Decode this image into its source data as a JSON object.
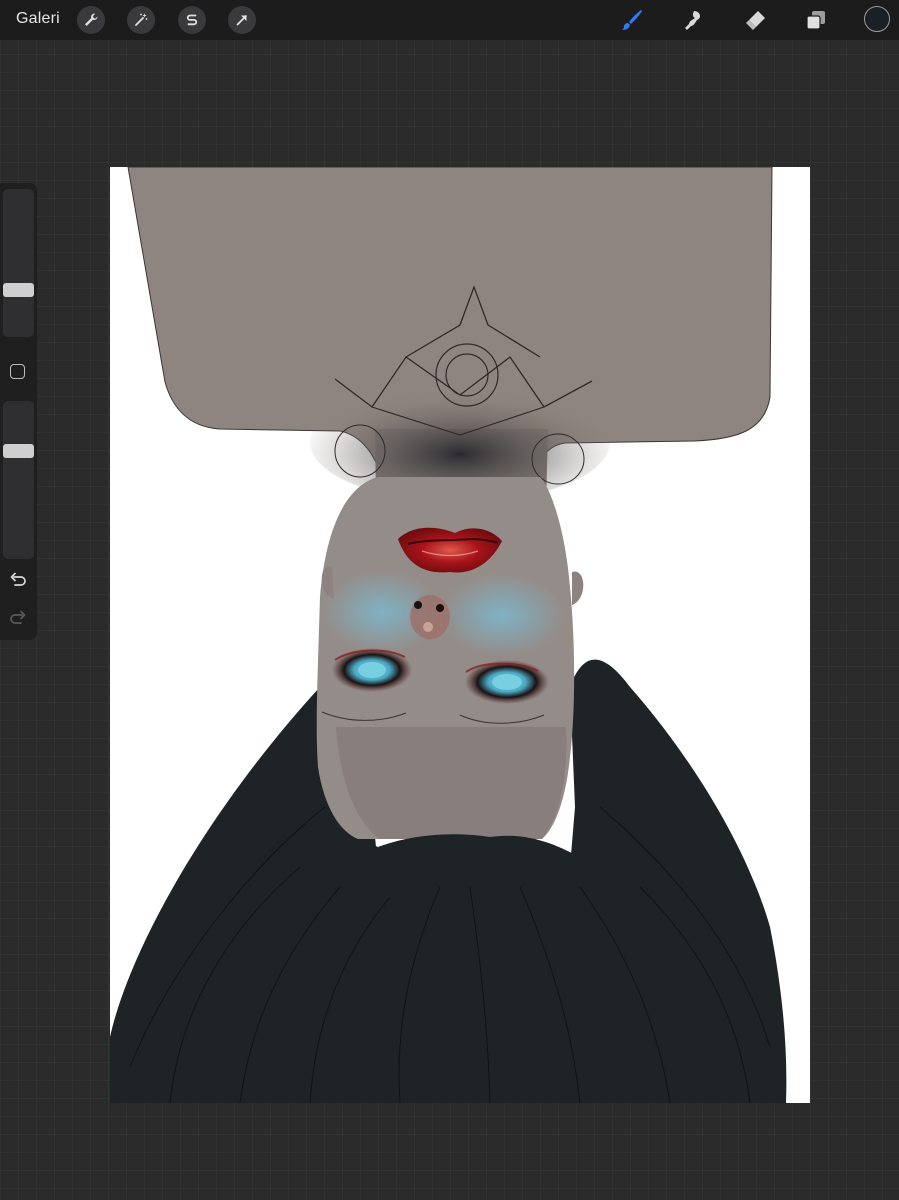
{
  "app": {
    "gallery_label": "Galeri"
  },
  "toolbar_left": [
    {
      "name": "actions-wrench-icon"
    },
    {
      "name": "adjustments-magic-wand-icon"
    },
    {
      "name": "selection-s-icon"
    },
    {
      "name": "transform-arrow-icon"
    }
  ],
  "toolbar_right": [
    {
      "name": "brush-icon",
      "active": true
    },
    {
      "name": "smudge-icon",
      "active": false
    },
    {
      "name": "eraser-icon",
      "active": false
    },
    {
      "name": "layers-icon",
      "active": false
    }
  ],
  "colors": {
    "active_tool": "#2f7cf6",
    "current_color": "#1b2026",
    "icon_default": "#d9d9d9"
  },
  "sidebar": {
    "brush_size_level": 0.3,
    "opacity_level": 0.7,
    "icons": [
      "modify-square-icon",
      "undo-icon",
      "redo-icon"
    ]
  }
}
